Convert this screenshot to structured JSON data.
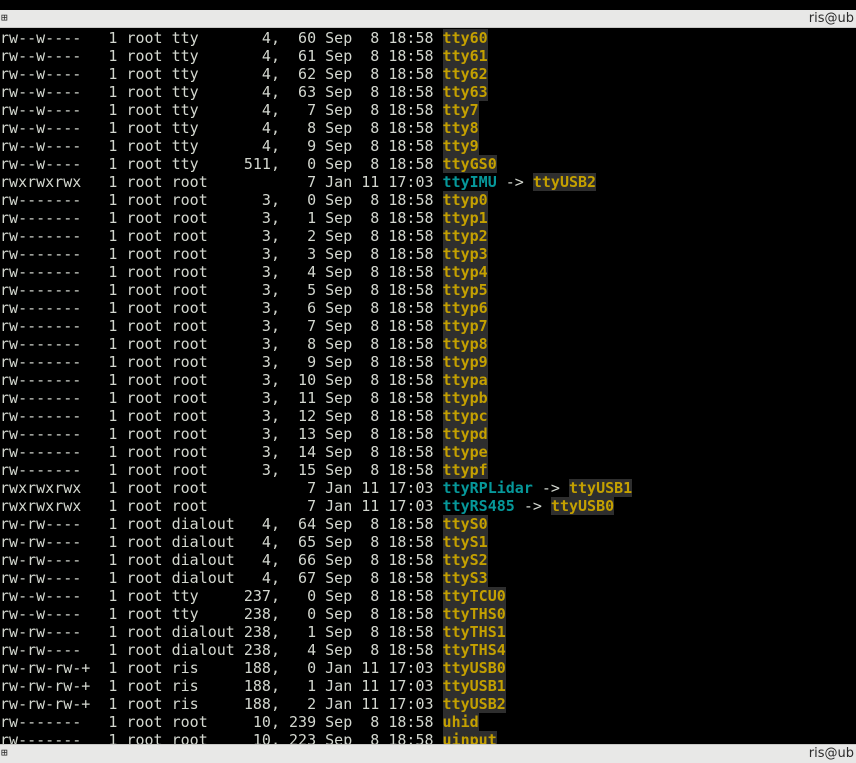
{
  "window": {
    "top_title": "ris@ub",
    "bottom_title": "ris@ub",
    "icon_glyph": "⊞"
  },
  "colors": {
    "device_name": "#c4a000",
    "symlink_name": "#06989a",
    "text": "#d3d7cf",
    "background": "#000000"
  },
  "listing": [
    {
      "perm": "crw--w----",
      "links": "1",
      "owner": "root",
      "group": "tty",
      "size": "4,  60",
      "month": "Sep",
      "day": "8",
      "time": "18:58",
      "name": "tty60"
    },
    {
      "perm": "crw--w----",
      "links": "1",
      "owner": "root",
      "group": "tty",
      "size": "4,  61",
      "month": "Sep",
      "day": "8",
      "time": "18:58",
      "name": "tty61"
    },
    {
      "perm": "crw--w----",
      "links": "1",
      "owner": "root",
      "group": "tty",
      "size": "4,  62",
      "month": "Sep",
      "day": "8",
      "time": "18:58",
      "name": "tty62"
    },
    {
      "perm": "crw--w----",
      "links": "1",
      "owner": "root",
      "group": "tty",
      "size": "4,  63",
      "month": "Sep",
      "day": "8",
      "time": "18:58",
      "name": "tty63"
    },
    {
      "perm": "crw--w----",
      "links": "1",
      "owner": "root",
      "group": "tty",
      "size": "4,   7",
      "month": "Sep",
      "day": "8",
      "time": "18:58",
      "name": "tty7"
    },
    {
      "perm": "crw--w----",
      "links": "1",
      "owner": "root",
      "group": "tty",
      "size": "4,   8",
      "month": "Sep",
      "day": "8",
      "time": "18:58",
      "name": "tty8"
    },
    {
      "perm": "crw--w----",
      "links": "1",
      "owner": "root",
      "group": "tty",
      "size": "4,   9",
      "month": "Sep",
      "day": "8",
      "time": "18:58",
      "name": "tty9"
    },
    {
      "perm": "crw--w----",
      "links": "1",
      "owner": "root",
      "group": "tty",
      "size": "511,   0",
      "month": "Sep",
      "day": "8",
      "time": "18:58",
      "name": "ttyGS0"
    },
    {
      "perm": "lrwxrwxrwx",
      "links": "1",
      "owner": "root",
      "group": "root",
      "size": "7",
      "month": "Jan",
      "day": "11",
      "time": "17:03",
      "name": "ttyIMU",
      "target": "ttyUSB2"
    },
    {
      "perm": "crw-------",
      "links": "1",
      "owner": "root",
      "group": "root",
      "size": "3,   0",
      "month": "Sep",
      "day": "8",
      "time": "18:58",
      "name": "ttyp0"
    },
    {
      "perm": "crw-------",
      "links": "1",
      "owner": "root",
      "group": "root",
      "size": "3,   1",
      "month": "Sep",
      "day": "8",
      "time": "18:58",
      "name": "ttyp1"
    },
    {
      "perm": "crw-------",
      "links": "1",
      "owner": "root",
      "group": "root",
      "size": "3,   2",
      "month": "Sep",
      "day": "8",
      "time": "18:58",
      "name": "ttyp2"
    },
    {
      "perm": "crw-------",
      "links": "1",
      "owner": "root",
      "group": "root",
      "size": "3,   3",
      "month": "Sep",
      "day": "8",
      "time": "18:58",
      "name": "ttyp3"
    },
    {
      "perm": "crw-------",
      "links": "1",
      "owner": "root",
      "group": "root",
      "size": "3,   4",
      "month": "Sep",
      "day": "8",
      "time": "18:58",
      "name": "ttyp4"
    },
    {
      "perm": "crw-------",
      "links": "1",
      "owner": "root",
      "group": "root",
      "size": "3,   5",
      "month": "Sep",
      "day": "8",
      "time": "18:58",
      "name": "ttyp5"
    },
    {
      "perm": "crw-------",
      "links": "1",
      "owner": "root",
      "group": "root",
      "size": "3,   6",
      "month": "Sep",
      "day": "8",
      "time": "18:58",
      "name": "ttyp6"
    },
    {
      "perm": "crw-------",
      "links": "1",
      "owner": "root",
      "group": "root",
      "size": "3,   7",
      "month": "Sep",
      "day": "8",
      "time": "18:58",
      "name": "ttyp7"
    },
    {
      "perm": "crw-------",
      "links": "1",
      "owner": "root",
      "group": "root",
      "size": "3,   8",
      "month": "Sep",
      "day": "8",
      "time": "18:58",
      "name": "ttyp8"
    },
    {
      "perm": "crw-------",
      "links": "1",
      "owner": "root",
      "group": "root",
      "size": "3,   9",
      "month": "Sep",
      "day": "8",
      "time": "18:58",
      "name": "ttyp9"
    },
    {
      "perm": "crw-------",
      "links": "1",
      "owner": "root",
      "group": "root",
      "size": "3,  10",
      "month": "Sep",
      "day": "8",
      "time": "18:58",
      "name": "ttypa"
    },
    {
      "perm": "crw-------",
      "links": "1",
      "owner": "root",
      "group": "root",
      "size": "3,  11",
      "month": "Sep",
      "day": "8",
      "time": "18:58",
      "name": "ttypb"
    },
    {
      "perm": "crw-------",
      "links": "1",
      "owner": "root",
      "group": "root",
      "size": "3,  12",
      "month": "Sep",
      "day": "8",
      "time": "18:58",
      "name": "ttypc"
    },
    {
      "perm": "crw-------",
      "links": "1",
      "owner": "root",
      "group": "root",
      "size": "3,  13",
      "month": "Sep",
      "day": "8",
      "time": "18:58",
      "name": "ttypd"
    },
    {
      "perm": "crw-------",
      "links": "1",
      "owner": "root",
      "group": "root",
      "size": "3,  14",
      "month": "Sep",
      "day": "8",
      "time": "18:58",
      "name": "ttype"
    },
    {
      "perm": "crw-------",
      "links": "1",
      "owner": "root",
      "group": "root",
      "size": "3,  15",
      "month": "Sep",
      "day": "8",
      "time": "18:58",
      "name": "ttypf"
    },
    {
      "perm": "lrwxrwxrwx",
      "links": "1",
      "owner": "root",
      "group": "root",
      "size": "7",
      "month": "Jan",
      "day": "11",
      "time": "17:03",
      "name": "ttyRPLidar",
      "target": "ttyUSB1"
    },
    {
      "perm": "lrwxrwxrwx",
      "links": "1",
      "owner": "root",
      "group": "root",
      "size": "7",
      "month": "Jan",
      "day": "11",
      "time": "17:03",
      "name": "ttyRS485",
      "target": "ttyUSB0"
    },
    {
      "perm": "crw-rw----",
      "links": "1",
      "owner": "root",
      "group": "dialout",
      "size": "4,  64",
      "month": "Sep",
      "day": "8",
      "time": "18:58",
      "name": "ttyS0"
    },
    {
      "perm": "crw-rw----",
      "links": "1",
      "owner": "root",
      "group": "dialout",
      "size": "4,  65",
      "month": "Sep",
      "day": "8",
      "time": "18:58",
      "name": "ttyS1"
    },
    {
      "perm": "crw-rw----",
      "links": "1",
      "owner": "root",
      "group": "dialout",
      "size": "4,  66",
      "month": "Sep",
      "day": "8",
      "time": "18:58",
      "name": "ttyS2"
    },
    {
      "perm": "crw-rw----",
      "links": "1",
      "owner": "root",
      "group": "dialout",
      "size": "4,  67",
      "month": "Sep",
      "day": "8",
      "time": "18:58",
      "name": "ttyS3"
    },
    {
      "perm": "crw--w----",
      "links": "1",
      "owner": "root",
      "group": "tty",
      "size": "237,   0",
      "month": "Sep",
      "day": "8",
      "time": "18:58",
      "name": "ttyTCU0"
    },
    {
      "perm": "crw--w----",
      "links": "1",
      "owner": "root",
      "group": "tty",
      "size": "238,   0",
      "month": "Sep",
      "day": "8",
      "time": "18:58",
      "name": "ttyTHS0"
    },
    {
      "perm": "crw-rw----",
      "links": "1",
      "owner": "root",
      "group": "dialout",
      "size": "238,   1",
      "month": "Sep",
      "day": "8",
      "time": "18:58",
      "name": "ttyTHS1"
    },
    {
      "perm": "crw-rw----",
      "links": "1",
      "owner": "root",
      "group": "dialout",
      "size": "238,   4",
      "month": "Sep",
      "day": "8",
      "time": "18:58",
      "name": "ttyTHS4"
    },
    {
      "perm": "crw-rw-rw-+",
      "links": "1",
      "owner": "root",
      "group": "ris",
      "size": "188,   0",
      "month": "Jan",
      "day": "11",
      "time": "17:03",
      "name": "ttyUSB0"
    },
    {
      "perm": "crw-rw-rw-+",
      "links": "1",
      "owner": "root",
      "group": "ris",
      "size": "188,   1",
      "month": "Jan",
      "day": "11",
      "time": "17:03",
      "name": "ttyUSB1"
    },
    {
      "perm": "crw-rw-rw-+",
      "links": "1",
      "owner": "root",
      "group": "ris",
      "size": "188,   2",
      "month": "Jan",
      "day": "11",
      "time": "17:03",
      "name": "ttyUSB2"
    },
    {
      "perm": "crw-------",
      "links": "1",
      "owner": "root",
      "group": "root",
      "size": "10, 239",
      "month": "Sep",
      "day": "8",
      "time": "18:58",
      "name": "uhid"
    },
    {
      "perm": "crw-------",
      "links": "1",
      "owner": "root",
      "group": "root",
      "size": "10, 223",
      "month": "Sep",
      "day": "8",
      "time": "18:58",
      "name": "uinput"
    }
  ]
}
